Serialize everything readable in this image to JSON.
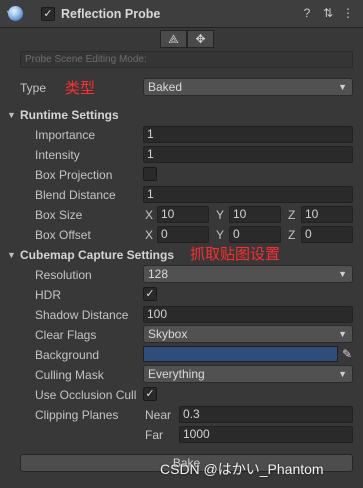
{
  "header": {
    "title": "Reflection Probe",
    "component_icon": "reflection-probe-icon",
    "enabled": "✓",
    "help_icon": "?",
    "presets_icon": "⇅",
    "menu_icon": "⋮"
  },
  "toolbar": {
    "edit_bounds_icon": "⟁",
    "move_origin_icon": "✥",
    "mode_text": "Probe Scene Editing Mode:"
  },
  "type_row": {
    "label": "Type",
    "annotation": "类型",
    "value": "Baked"
  },
  "runtime": {
    "title": "Runtime Settings",
    "importance": {
      "label": "Importance",
      "value": "1"
    },
    "intensity": {
      "label": "Intensity",
      "value": "1"
    },
    "box_projection": {
      "label": "Box Projection"
    },
    "blend_distance": {
      "label": "Blend Distance",
      "value": "1"
    },
    "box_size": {
      "label": "Box Size",
      "x": "10",
      "y": "10",
      "z": "10"
    },
    "box_offset": {
      "label": "Box Offset",
      "x": "0",
      "y": "0",
      "z": "0"
    },
    "axes": {
      "x": "X",
      "y": "Y",
      "z": "Z"
    }
  },
  "cubemap": {
    "title": "Cubemap Capture Settings",
    "annotation": "抓取贴图设置",
    "resolution": {
      "label": "Resolution",
      "value": "128"
    },
    "hdr": {
      "label": "HDR",
      "check": "✓"
    },
    "shadow_distance": {
      "label": "Shadow Distance",
      "value": "100"
    },
    "clear_flags": {
      "label": "Clear Flags",
      "value": "Skybox"
    },
    "background": {
      "label": "Background",
      "color": "#2f4d7c"
    },
    "culling_mask": {
      "label": "Culling Mask",
      "value": "Everything"
    },
    "occlusion": {
      "label": "Use Occlusion Cull",
      "check": "✓"
    },
    "clipping": {
      "label": "Clipping Planes",
      "near_label": "Near",
      "near": "0.3",
      "far_label": "Far",
      "far": "1000"
    }
  },
  "bake_button": "Bake",
  "watermark": "CSDN @はかい_Phantom",
  "colors": {
    "annotation": "#ff2d2d",
    "background_swatch": "#2f4d7c"
  }
}
